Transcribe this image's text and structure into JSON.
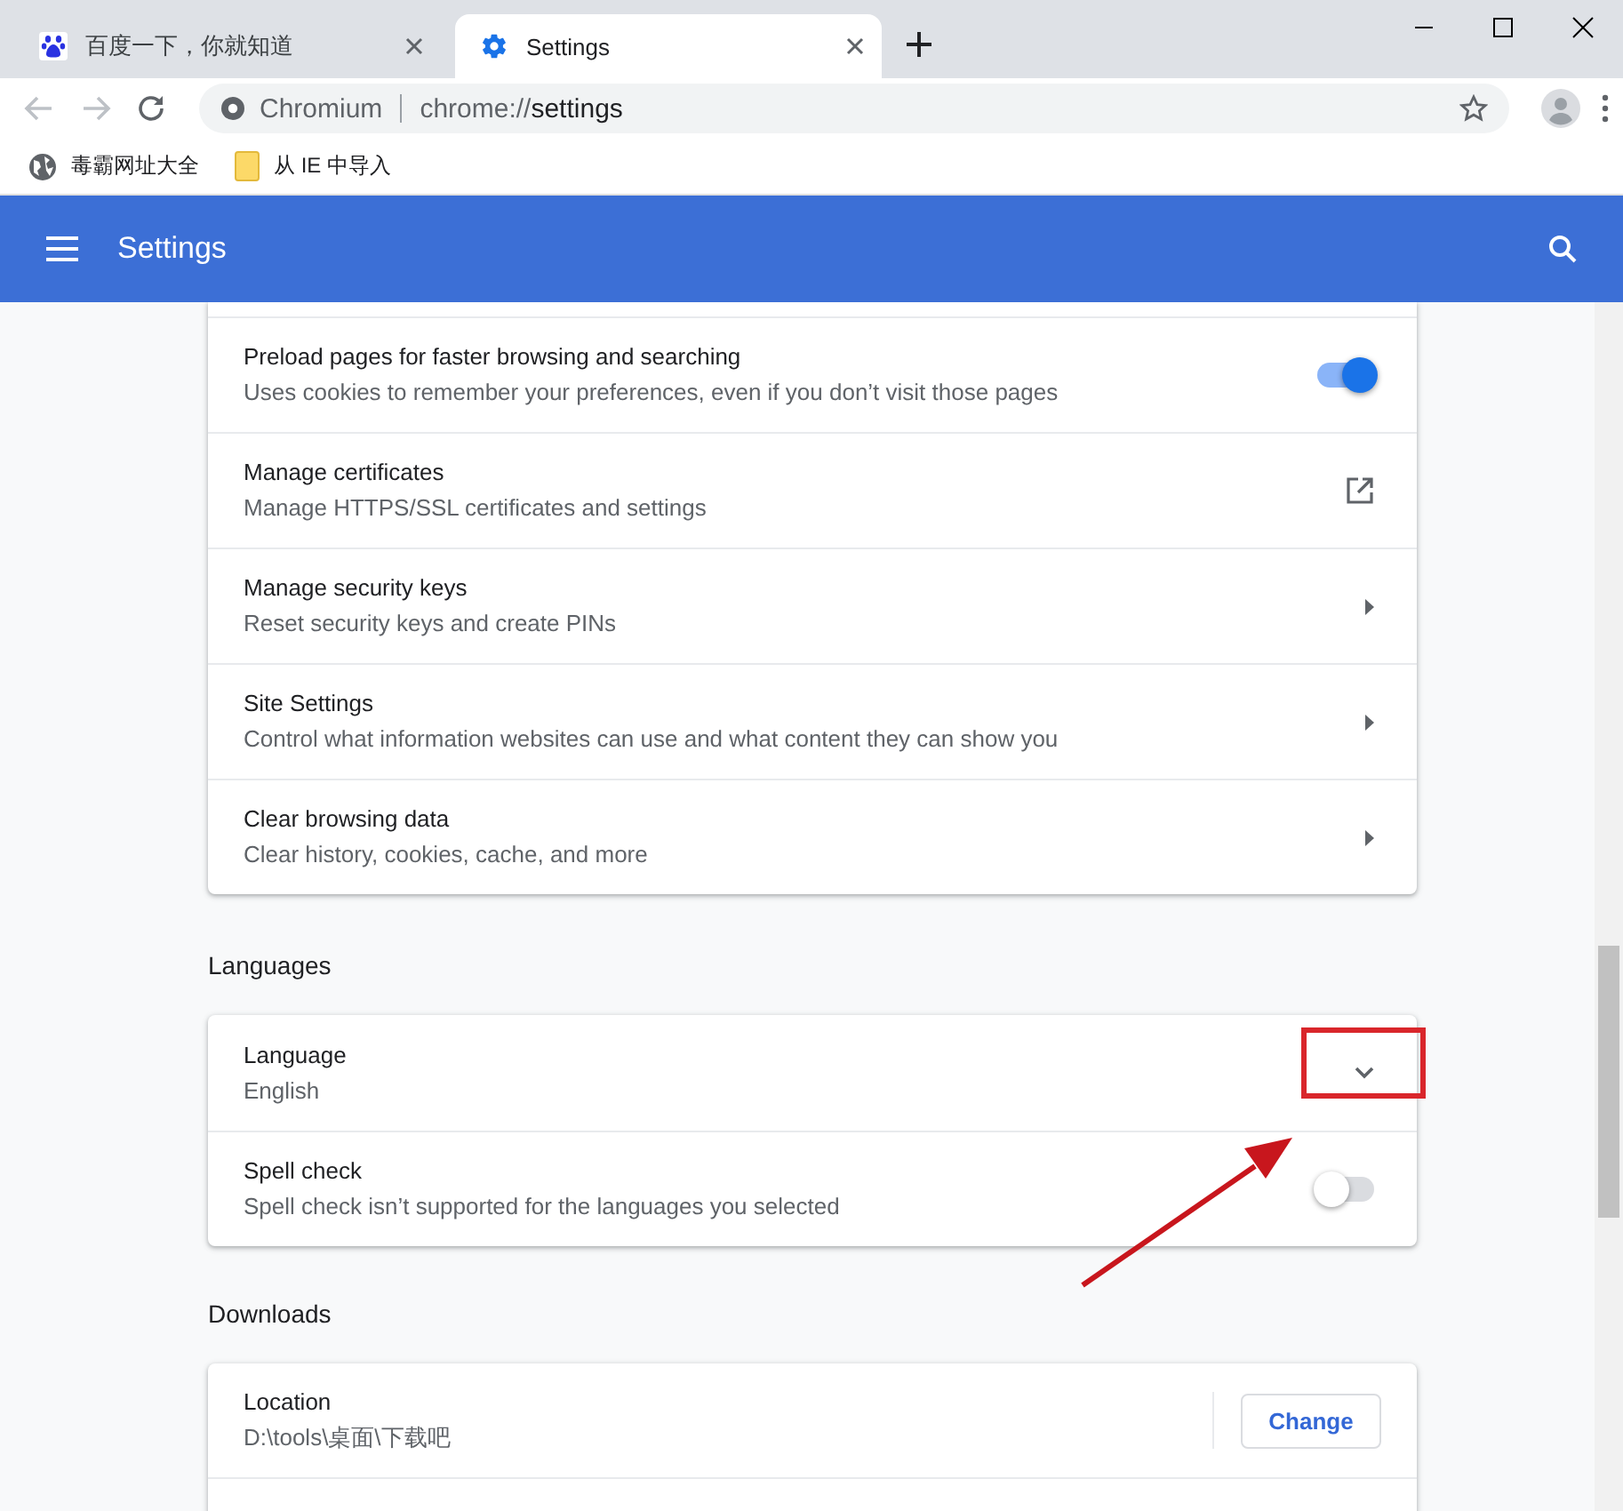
{
  "tabs": [
    {
      "title": "百度一下，你就知道",
      "selected": false
    },
    {
      "title": "Settings",
      "selected": true
    }
  ],
  "omnibox": {
    "site": "Chromium",
    "url_scheme": "chrome://",
    "url_path": "settings"
  },
  "bookmarks": [
    {
      "label": "毒霸网址大全"
    },
    {
      "label": "从 IE 中导入"
    }
  ],
  "header": {
    "title": "Settings"
  },
  "sections": [
    {
      "rows": [
        {
          "kind": "toggle",
          "label": "Preload pages for faster browsing and searching",
          "sublabel": "Uses cookies to remember your preferences, even if you don’t visit those pages",
          "on": true
        },
        {
          "kind": "external",
          "label": "Manage certificates",
          "sublabel": "Manage HTTPS/SSL certificates and settings"
        },
        {
          "kind": "arrow",
          "label": "Manage security keys",
          "sublabel": "Reset security keys and create PINs"
        },
        {
          "kind": "arrow",
          "label": "Site Settings",
          "sublabel": "Control what information websites can use and what content they can show you"
        },
        {
          "kind": "arrow",
          "label": "Clear browsing data",
          "sublabel": "Clear history, cookies, cache, and more"
        }
      ]
    },
    {
      "heading": "Languages",
      "rows": [
        {
          "kind": "expand",
          "label": "Language",
          "sublabel": "English"
        },
        {
          "kind": "toggle",
          "label": "Spell check",
          "sublabel": "Spell check isn’t supported for the languages you selected",
          "on": false
        }
      ]
    },
    {
      "heading": "Downloads",
      "rows": [
        {
          "kind": "button",
          "label": "Location",
          "sublabel": "D:\\tools\\桌面\\下载吧",
          "button": "Change"
        }
      ]
    }
  ]
}
